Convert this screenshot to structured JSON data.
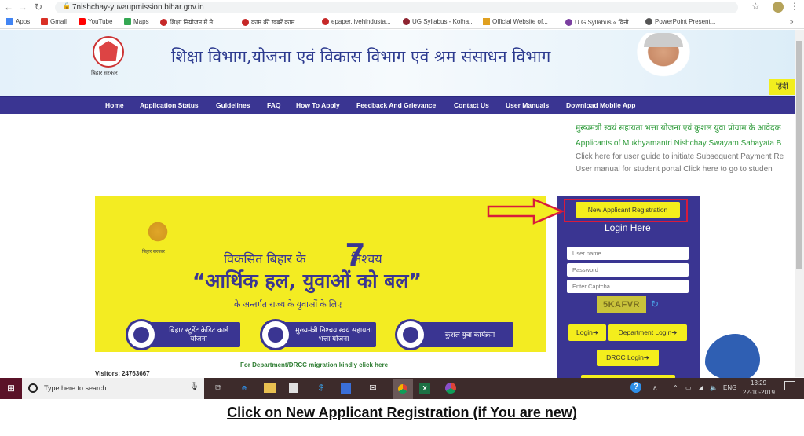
{
  "browser": {
    "url": "7nishchay-yuvaupmission.bihar.gov.in",
    "bookmarks": [
      {
        "label": "Apps",
        "color": "#4285f4"
      },
      {
        "label": "Gmail",
        "color": "#d93025"
      },
      {
        "label": "YouTube",
        "color": "#ff0000"
      },
      {
        "label": "Maps",
        "color": "#34a853"
      },
      {
        "label": "शिक्षा नियोजन में मे...",
        "color": "#c62828"
      },
      {
        "label": "काम की खबरें काम...",
        "color": "#c62828"
      },
      {
        "label": "epaper.livehindusta...",
        "color": "#c62828"
      },
      {
        "label": "UG Syllabus - Kolha...",
        "color": "#8e2430"
      },
      {
        "label": "Official Website of...",
        "color": "#e0a020"
      },
      {
        "label": "U.G Syllabus « विनो...",
        "color": "#7a3fa0"
      },
      {
        "label": "PowerPoint Present...",
        "color": "#555555"
      }
    ],
    "more_bookmarks": "»"
  },
  "header": {
    "emblem_caption": "बिहार सरकार",
    "title": "शिक्षा विभाग,योजना एवं विकास विभाग एवं श्रम संसाधन विभाग",
    "language_button": "हिंदी"
  },
  "nav": {
    "items": [
      "Home",
      "Application Status",
      "Guidelines",
      "FAQ",
      "How To Apply",
      "Feedback And Grievance",
      "Contact Us",
      "User Manuals",
      "Download Mobile App"
    ]
  },
  "notices": [
    {
      "text": "मुख्यमंत्री स्वयं सहायता भत्ता योजना एवं कुशल युवा प्रोग्राम के आवेदक",
      "color": "#2e9b3a"
    },
    {
      "text": "Applicants of Mukhyamantri Nishchay Swayam Sahayata B",
      "color": "#2e9b3a"
    },
    {
      "text": "Click here for user guide to initiate Subsequent Payment Re",
      "color": "#777777"
    },
    {
      "text": "User manual for student portal      Click here to go to studen",
      "color": "#777777"
    }
  ],
  "banner": {
    "emblem_caption": "बिहार सरकार",
    "line1": "विकसित बिहार के",
    "number": "7",
    "line1_end": "निश्चय",
    "line2": "“आर्थिक हल, युवाओं को बल”",
    "line3": "के अन्तर्गत राज्य के युवाओं के लिए",
    "schemes": [
      "बिहार स्टूडेंट क्रेडिट कार्ड योजना",
      "मुख्यमंत्री निश्चय स्वयं सहायता भत्ता योजना",
      "कुशल युवा कार्यक्रम"
    ]
  },
  "migration_link": "For Department/DRCC migration kindly click here",
  "visitors": "Visitors: 24763667",
  "login": {
    "new_registration": "New Applicant Registration",
    "heading": "Login Here",
    "username_placeholder": "User name",
    "password_placeholder": "Password",
    "captcha_placeholder": "Enter Captcha",
    "captcha_code": "5KAFVR",
    "login_button": "Login➜",
    "department_login_button": "Department Login➜",
    "drcc_login_button": "DRCC Login➜"
  },
  "taskbar": {
    "search_placeholder": "Type here to search",
    "language": "ENG",
    "time": "13:29",
    "date": "22-10-2019"
  },
  "caption": "Click on New Applicant Registration (if You are new)",
  "colors": {
    "nav_bg": "#3a3592",
    "accent_yellow": "#f3ec22",
    "highlight_red": "#d81b3c"
  }
}
